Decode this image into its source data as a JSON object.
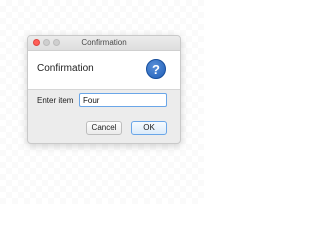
{
  "window": {
    "title": "Confirmation"
  },
  "header": {
    "title": "Confirmation",
    "icon": "question-icon",
    "icon_glyph": "?"
  },
  "form": {
    "label": "Enter item",
    "input_value": "Four"
  },
  "buttons": {
    "cancel_label": "Cancel",
    "ok_label": "OK"
  },
  "colors": {
    "close": "#ff5f57",
    "accent": "#6aa6e8",
    "icon_blue": "#1f5fb8"
  }
}
